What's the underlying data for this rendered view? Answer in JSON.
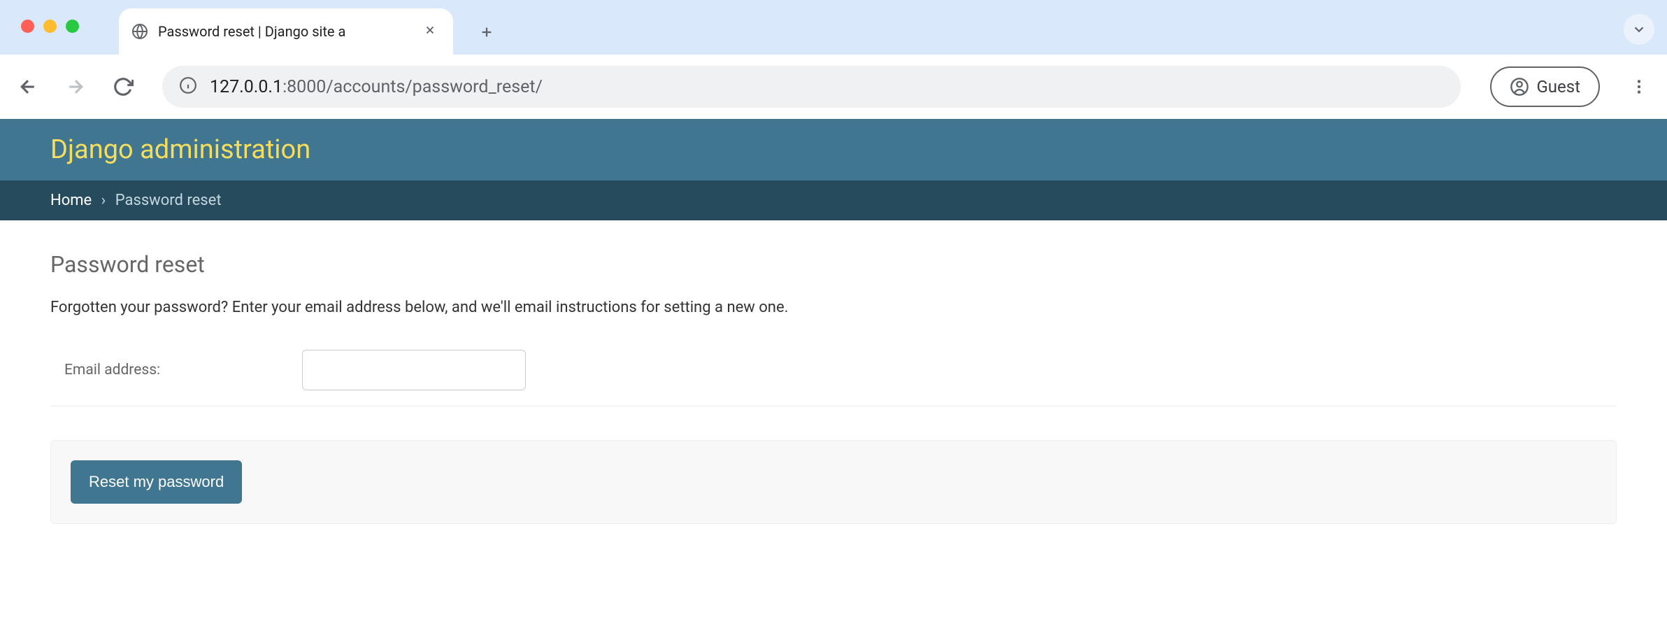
{
  "browser": {
    "tab_title": "Password reset | Django site a",
    "url_host": "127.0.0.1",
    "url_port_path": ":8000/accounts/password_reset/",
    "profile_label": "Guest"
  },
  "header": {
    "site_title": "Django administration"
  },
  "breadcrumb": {
    "home": "Home",
    "separator": "›",
    "current": "Password reset"
  },
  "page": {
    "heading": "Password reset",
    "instructions": "Forgotten your password? Enter your email address below, and we'll email instructions for setting a new one.",
    "email_label": "Email address:",
    "email_value": "",
    "submit_label": "Reset my password"
  }
}
